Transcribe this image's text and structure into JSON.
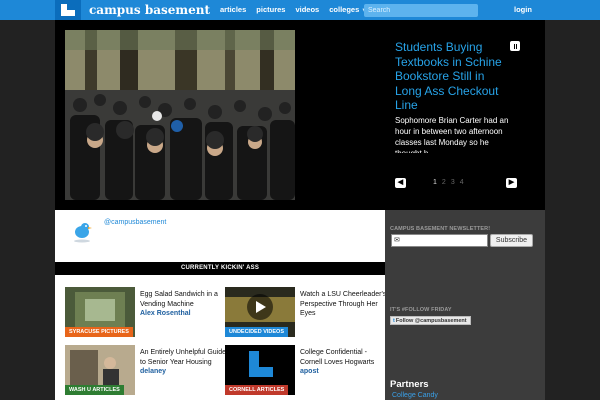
{
  "nav": {
    "brand": "campus basement",
    "links": [
      "articles",
      "pictures",
      "videos",
      "colleges"
    ],
    "search_placeholder": "Search",
    "login": "login"
  },
  "hero": {
    "title": "Students Buying Textbooks in Schine Bookstore Still in Long Ass Checkout Line",
    "body": "Sophomore Brian Carter had an hour in between two afternoon classes last Monday so he thought h",
    "pages": [
      "1",
      "2",
      "3",
      "4"
    ],
    "active_page": "1",
    "prev_icon": "arrow-left-icon",
    "next_icon": "arrow-right-icon"
  },
  "twitter": {
    "handle": "@campusbasement"
  },
  "kickin": {
    "heading": "CURRENTLY KICKIN' ASS"
  },
  "articles": [
    {
      "tag": "SYRACUSE PICTURES",
      "tag_color": "#e8651a",
      "title": "Egg Salad Sandwich in a Vending Machine",
      "author": "Alex Rosenthal"
    },
    {
      "tag": "UNDECIDED VIDEOS",
      "tag_color": "#1e88d7",
      "title": "Watch a LSU Cheerleader's Perspective Through Her Eyes",
      "author": ""
    },
    {
      "tag": "WASH U ARTICLES",
      "tag_color": "#2e7d32",
      "title": "An Entirely Unhelpful Guide to Senior Year Housing",
      "author": "delaney"
    },
    {
      "tag": "CORNELL ARTICLES",
      "tag_color": "#c0392b",
      "title": "College Confidential - Cornell Loves Hogwarts",
      "author": "apost"
    }
  ],
  "sidebar": {
    "newsletter_heading": "CAMPUS BASEMENT NEWSLETTER!",
    "subscribe_label": "Subscribe",
    "follow_heading": "IT'S #FOLLOW FRIDAY",
    "follow_button": "Follow @campusbasement",
    "partners_heading": "Partners",
    "partner_link": "College Candy"
  },
  "colors": {
    "accent": "#1e88d7",
    "hero_title": "#27a3e8",
    "background": "#1e1e1e"
  }
}
